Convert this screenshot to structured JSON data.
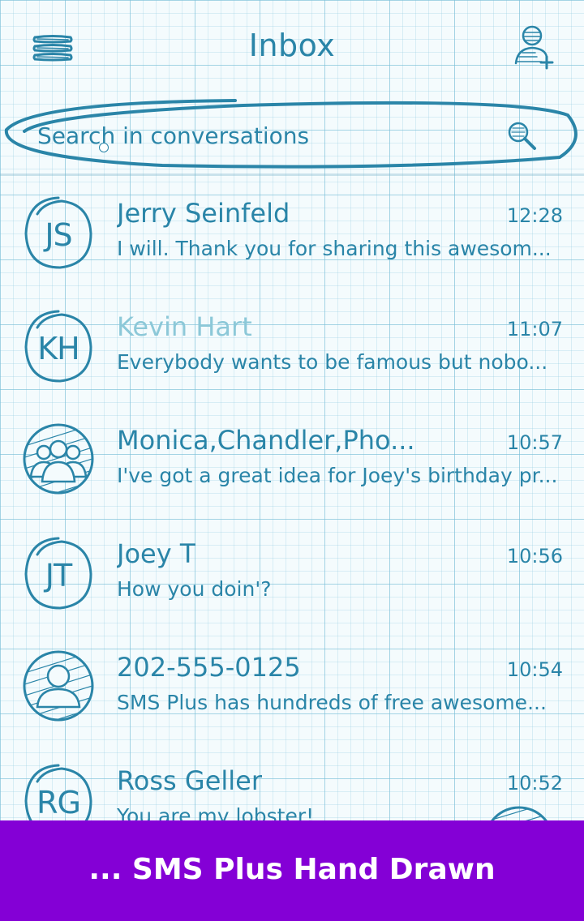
{
  "header": {
    "title": "Inbox",
    "menu_icon": "hamburger-menu-icon",
    "add_contact_icon": "add-contact-icon"
  },
  "search": {
    "placeholder": "Search in conversations",
    "icon": "search-icon"
  },
  "conversations": [
    {
      "initials": "JS",
      "name": "Jerry Seinfeld",
      "time": "12:28",
      "snippet": "I will. Thank you for sharing this awesom...",
      "avatar_type": "initials",
      "unread": false
    },
    {
      "initials": "KH",
      "name": "Kevin Hart",
      "time": "11:07",
      "snippet": "Everybody wants to be famous but nobo...",
      "avatar_type": "initials",
      "unread": true
    },
    {
      "initials": "",
      "name": "Monica,Chandler,Pho...",
      "time": "10:57",
      "snippet": "I've got a great idea for Joey's birthday pr...",
      "avatar_type": "group",
      "unread": false
    },
    {
      "initials": "JT",
      "name": "Joey T",
      "time": "10:56",
      "snippet": "How you doin'?",
      "avatar_type": "initials",
      "unread": false
    },
    {
      "initials": "",
      "name": "202-555-0125",
      "time": "10:54",
      "snippet": "SMS Plus has hundreds of free awesome...",
      "avatar_type": "person",
      "unread": false
    },
    {
      "initials": "RG",
      "name": "Ross Geller",
      "time": "10:52",
      "snippet": "You are my lobster!",
      "avatar_type": "initials",
      "unread": false
    }
  ],
  "footer": {
    "text": "... SMS Plus Hand Drawn"
  },
  "colors": {
    "ink": "#2a85a8",
    "ink_light": "#8cc8d8",
    "footer_bg": "#8400d6",
    "paper": "#f4fbfd"
  }
}
